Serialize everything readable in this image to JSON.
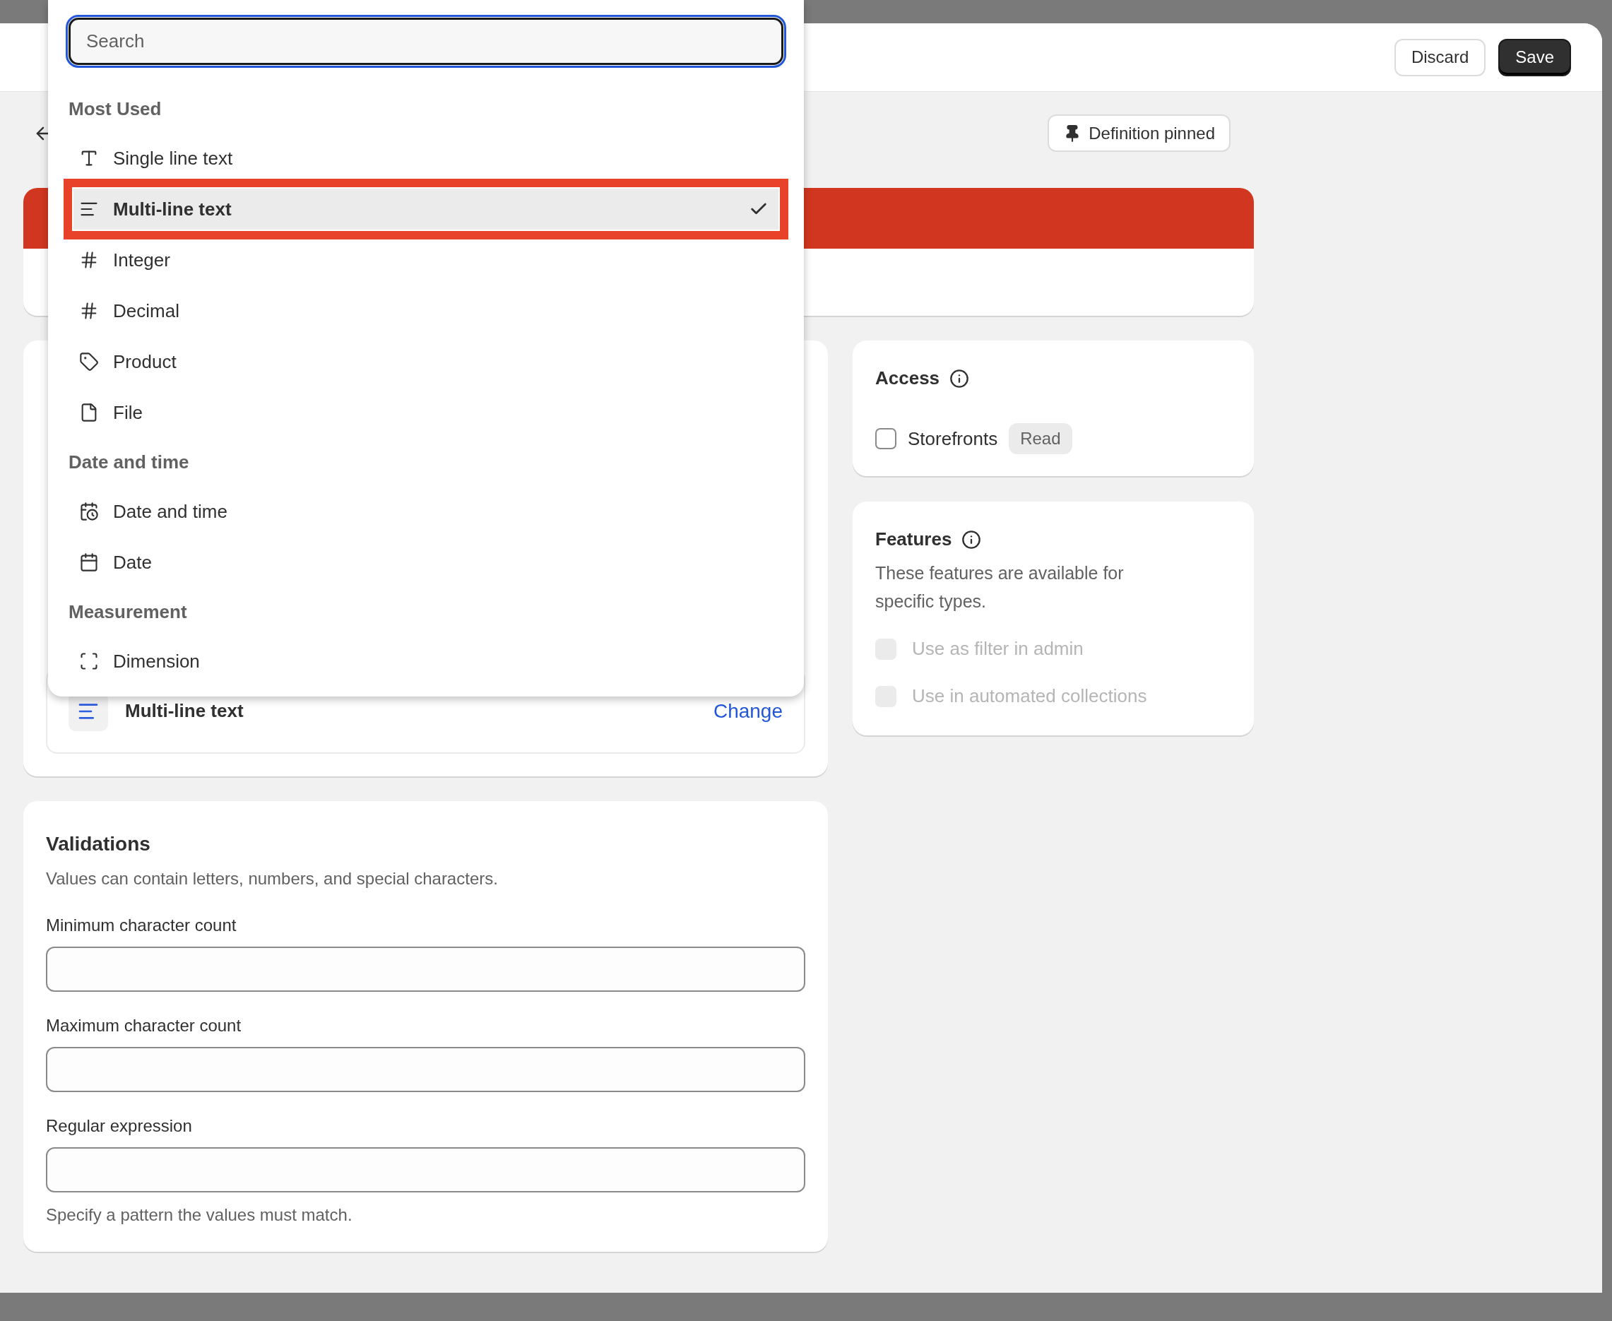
{
  "header": {
    "buttons": [
      {
        "label": "Discard",
        "kind": "secondary"
      },
      {
        "label": "Save",
        "kind": "primary"
      }
    ]
  },
  "pinned_button": {
    "label": "Definition pinned"
  },
  "type_picker": {
    "search": {
      "placeholder": "Search"
    },
    "groups": [
      {
        "title": "Most Used",
        "items": [
          {
            "label": "Single line text",
            "kind": "text",
            "selected": false
          },
          {
            "label": "Multi-line text",
            "kind": "multiline",
            "selected": true
          },
          {
            "label": "Integer",
            "kind": "number",
            "selected": false
          },
          {
            "label": "Decimal",
            "kind": "number",
            "selected": false
          },
          {
            "label": "Product",
            "kind": "product",
            "selected": false
          },
          {
            "label": "File",
            "kind": "file",
            "selected": false
          }
        ]
      },
      {
        "title": "Date and time",
        "items": [
          {
            "label": "Date and time",
            "kind": "datetime",
            "selected": false
          },
          {
            "label": "Date",
            "kind": "date",
            "selected": false
          }
        ]
      },
      {
        "title": "Measurement",
        "items": [
          {
            "label": "Dimension",
            "kind": "dimension",
            "selected": false
          }
        ]
      }
    ]
  },
  "selected_type": {
    "label": "Multi-line text",
    "action": "Change"
  },
  "access": {
    "title": "Access",
    "option": {
      "label": "Storefronts",
      "checked": false,
      "badge": "Read"
    }
  },
  "features": {
    "title": "Features",
    "description": "These features are available for specific types.",
    "options": [
      {
        "label": "Use as filter in admin",
        "checked": false,
        "disabled": true
      },
      {
        "label": "Use in automated collections",
        "checked": false,
        "disabled": true
      }
    ]
  },
  "validations": {
    "title": "Validations",
    "description": "Values can contain letters, numbers, and special characters.",
    "fields": [
      {
        "label": "Minimum character count"
      },
      {
        "label": "Maximum character count"
      },
      {
        "label": "Regular expression",
        "help": "Specify a pattern the values must match."
      }
    ]
  }
}
